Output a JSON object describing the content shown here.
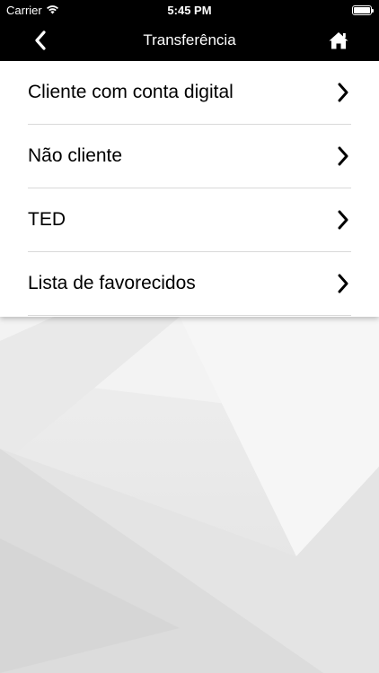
{
  "status_bar": {
    "carrier": "Carrier",
    "time": "5:45 PM"
  },
  "nav": {
    "title": "Transferência",
    "back_icon": "chevron-left-icon",
    "home_icon": "home-icon"
  },
  "menu": {
    "items": [
      {
        "label": "Cliente com conta digital"
      },
      {
        "label": "Não cliente"
      },
      {
        "label": "TED"
      },
      {
        "label": "Lista de favorecidos"
      }
    ]
  },
  "colors": {
    "bar": "#000000",
    "card": "#ffffff",
    "divider": "#d9d9d9",
    "background": "#ececec"
  }
}
